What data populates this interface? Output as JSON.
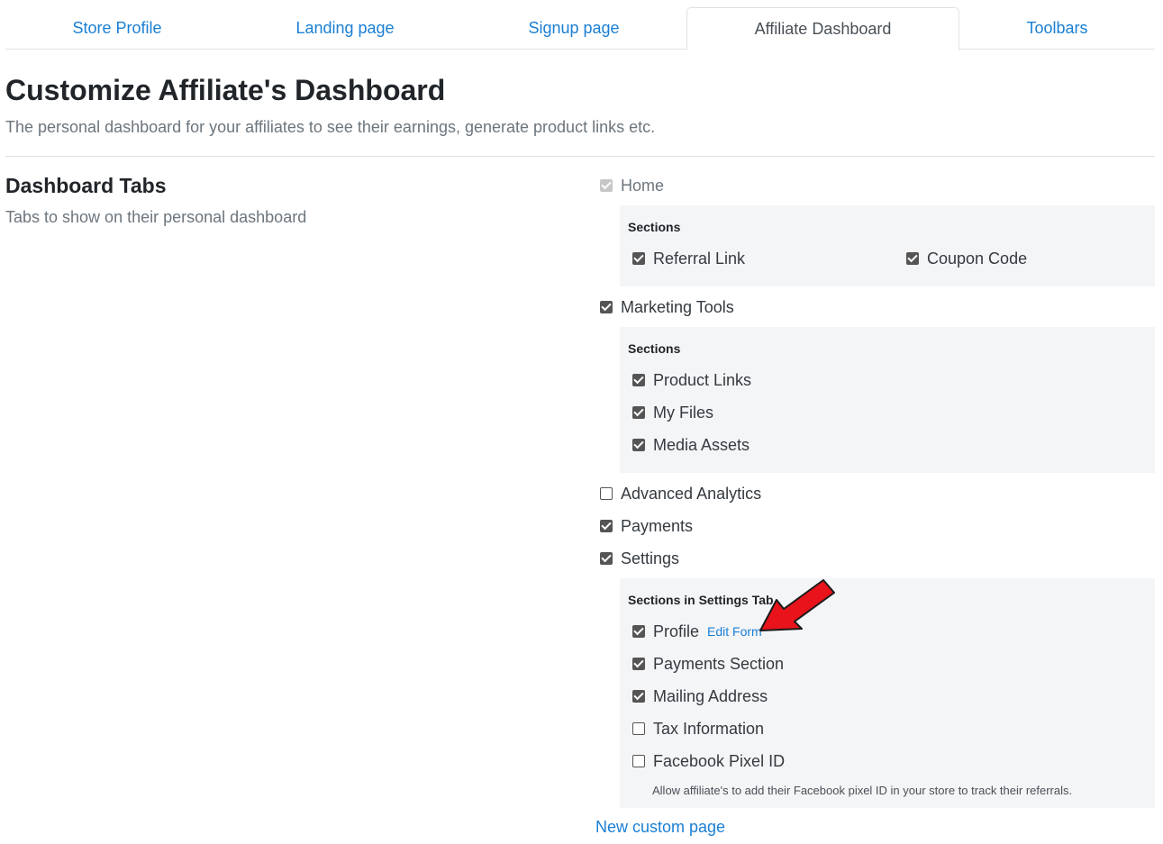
{
  "tabs": [
    {
      "label": "Store Profile"
    },
    {
      "label": "Landing page"
    },
    {
      "label": "Signup page"
    },
    {
      "label": "Affiliate Dashboard",
      "active": true
    },
    {
      "label": "Toolbars"
    }
  ],
  "header": {
    "title": "Customize Affiliate's Dashboard",
    "subtitle": "The personal dashboard for your affiliates to see their earnings, generate product links etc."
  },
  "dashboard_tabs": {
    "title": "Dashboard Tabs",
    "description": "Tabs to show on their personal dashboard",
    "home": {
      "label": "Home",
      "checked": true,
      "disabled": true,
      "sections_title": "Sections",
      "sections": [
        {
          "label": "Referral Link",
          "checked": true
        },
        {
          "label": "Coupon Code",
          "checked": true
        }
      ]
    },
    "marketing_tools": {
      "label": "Marketing Tools",
      "checked": true,
      "sections_title": "Sections",
      "sections": [
        {
          "label": "Product Links",
          "checked": true
        },
        {
          "label": "My Files",
          "checked": true
        },
        {
          "label": "Media Assets",
          "checked": true
        }
      ]
    },
    "advanced_analytics": {
      "label": "Advanced Analytics",
      "checked": false
    },
    "payments": {
      "label": "Payments",
      "checked": true
    },
    "settings": {
      "label": "Settings",
      "checked": true,
      "sections_title": "Sections in Settings Tab",
      "sections": [
        {
          "label": "Profile",
          "checked": true,
          "link": "Edit Form"
        },
        {
          "label": "Payments Section",
          "checked": true
        },
        {
          "label": "Mailing Address",
          "checked": true
        },
        {
          "label": "Tax Information",
          "checked": false
        },
        {
          "label": "Facebook Pixel ID",
          "checked": false
        }
      ],
      "facebook_help": "Allow affiliate's to add their Facebook pixel ID in your store to track their referrals."
    },
    "new_custom_page": "New custom page"
  },
  "colors": {
    "link": "#1a7fd4",
    "panel_bg": "#f4f5f7",
    "checkbox": "#555555",
    "annotation_arrow": "#e8131b"
  },
  "annotation": {
    "icon": "red-arrow-icon"
  }
}
